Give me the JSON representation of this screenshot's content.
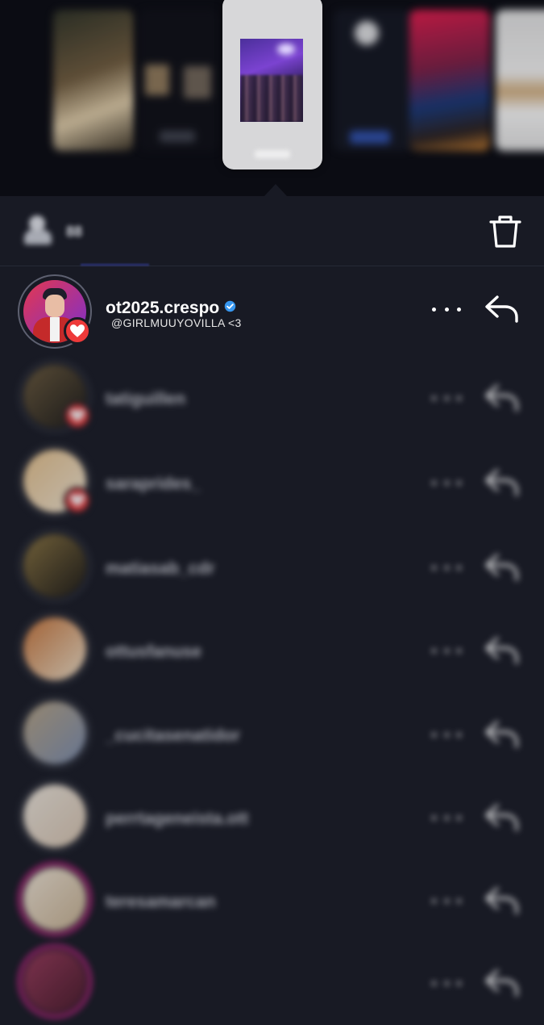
{
  "story_strip": {
    "thumbnails": [
      "story-thumb-1",
      "story-thumb-2",
      "story-thumb-current",
      "story-thumb-4",
      "story-thumb-5",
      "story-thumb-6"
    ]
  },
  "header": {
    "viewers_icon": "people-icon",
    "viewers_count": "88",
    "delete_icon": "trash-icon"
  },
  "viewers": [
    {
      "username": "ot2025.crespo",
      "verified": true,
      "subtitle": "@GIRLMUUYOVILLA <3",
      "liked": true,
      "ring": "#5d6070",
      "avatar_colors": [
        "#e4374f",
        "#7a2fd0"
      ]
    },
    {
      "username": "tatiguillen",
      "verified": false,
      "subtitle": "",
      "liked": true,
      "ring": "#2c2f3a",
      "avatar_colors": [
        "#6b5a3c",
        "#1c1a16"
      ]
    },
    {
      "username": "saraprides_",
      "verified": false,
      "subtitle": "",
      "liked": true,
      "ring": "#2c2f3a",
      "avatar_colors": [
        "#e7c28b",
        "#f3e7d3"
      ]
    },
    {
      "username": "matiasab_cdr",
      "verified": false,
      "subtitle": "",
      "liked": false,
      "ring": "#2c2f3a",
      "avatar_colors": [
        "#8a7440",
        "#1d1a14"
      ]
    },
    {
      "username": "ottusfanuse",
      "verified": false,
      "subtitle": "",
      "liked": false,
      "ring": "#2c2f3a",
      "avatar_colors": [
        "#c9763a",
        "#efe1c9"
      ]
    },
    {
      "username": "_cucitasenatidor",
      "verified": false,
      "subtitle": "",
      "liked": false,
      "ring": "#2c2f3a",
      "avatar_colors": [
        "#b9a686",
        "#7d8fb0"
      ]
    },
    {
      "username": "perrtageneista.ott",
      "verified": false,
      "subtitle": "",
      "liked": false,
      "ring": "#2c2f3a",
      "avatar_colors": [
        "#efe8dd",
        "#d9c6b1"
      ]
    },
    {
      "username": "teresamarcan",
      "verified": false,
      "subtitle": "",
      "liked": false,
      "ring": "#d4238e",
      "avatar_colors": [
        "#f1e6d6",
        "#c9b392"
      ]
    },
    {
      "username": "",
      "verified": false,
      "subtitle": "",
      "liked": false,
      "ring": "#d4238e",
      "avatar_colors": [
        "#9a3a5a",
        "#4a1a2a"
      ]
    }
  ],
  "row_icons": {
    "more": "more-horizontal-icon",
    "reply": "reply-arrow-icon",
    "like": "heart-icon",
    "verified": "verified-badge-icon"
  },
  "colors": {
    "background": "#181a24",
    "like_badge": "#ee3a3a",
    "verified": "#3797f0"
  }
}
